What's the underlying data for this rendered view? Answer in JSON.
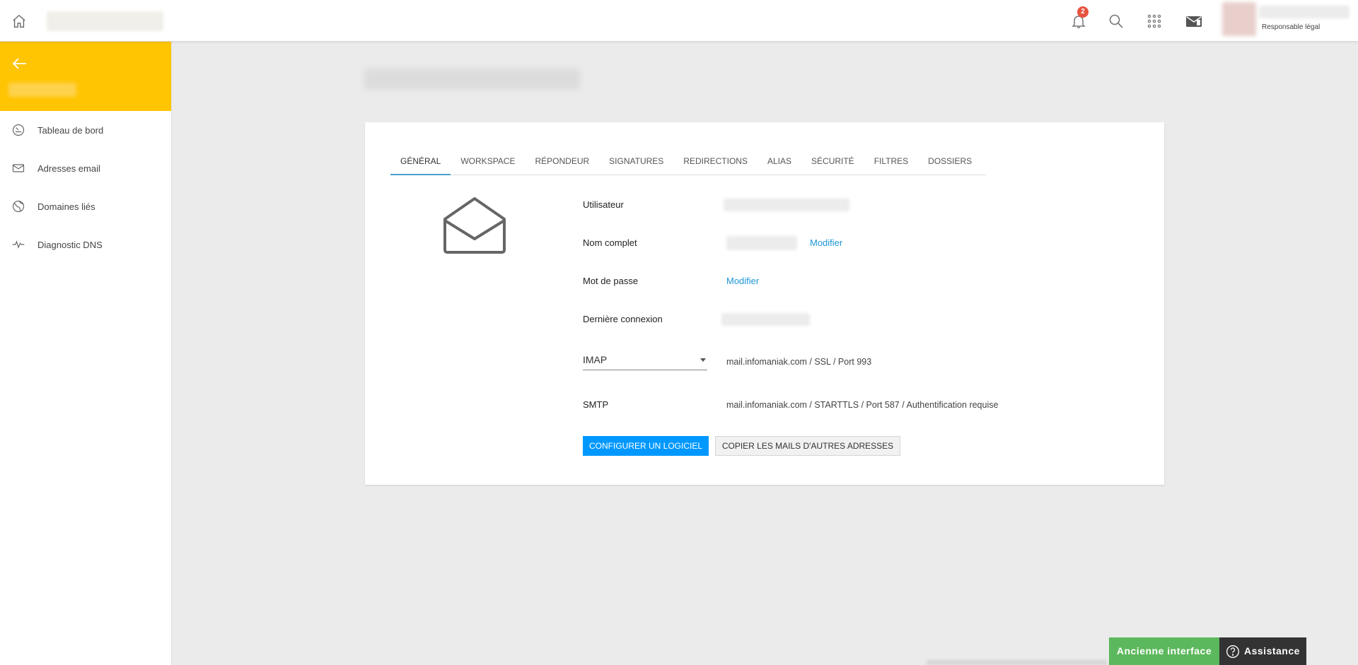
{
  "colors": {
    "accent": "#ffc402",
    "primary": "#0098ff",
    "link": "#1e96d3",
    "badge": "#e8533f",
    "success": "#5cb85c"
  },
  "header": {
    "notification_count": "2",
    "user_role": "Responsable légal",
    "icons": [
      "home-icon",
      "bell-icon",
      "search-icon",
      "apps-grid-icon",
      "mail-switch-icon"
    ]
  },
  "sidebar": {
    "items": [
      {
        "label": "Tableau de bord",
        "icon": "dashboard-icon"
      },
      {
        "label": "Adresses email",
        "icon": "envelope-icon"
      },
      {
        "label": "Domaines liés",
        "icon": "globe-icon"
      },
      {
        "label": "Diagnostic DNS",
        "icon": "pulse-icon"
      }
    ]
  },
  "tabs": [
    {
      "label": "Général",
      "active": true
    },
    {
      "label": "Workspace"
    },
    {
      "label": "Répondeur"
    },
    {
      "label": "Signatures"
    },
    {
      "label": "Redirections"
    },
    {
      "label": "Alias"
    },
    {
      "label": "Sécurité"
    },
    {
      "label": "Filtres"
    },
    {
      "label": "Dossiers"
    }
  ],
  "fields": {
    "user_label": "Utilisateur",
    "fullname_label": "Nom complet",
    "fullname_action": "Modifier",
    "password_label": "Mot de passe",
    "password_action": "Modifier",
    "last_login_label": "Dernière connexion",
    "protocol_selected": "IMAP",
    "imap_info": "mail.infomaniak.com / SSL / Port 993",
    "smtp_label": "SMTP",
    "smtp_info": "mail.infomaniak.com / STARTTLS / Port 587 / Authentification requise"
  },
  "actions": {
    "configure": "Configurer un logiciel",
    "copy_mails": "Copier les mails d'autres adresses"
  },
  "footer": {
    "old_interface": "Ancienne interface",
    "assistance": "Assistance"
  }
}
